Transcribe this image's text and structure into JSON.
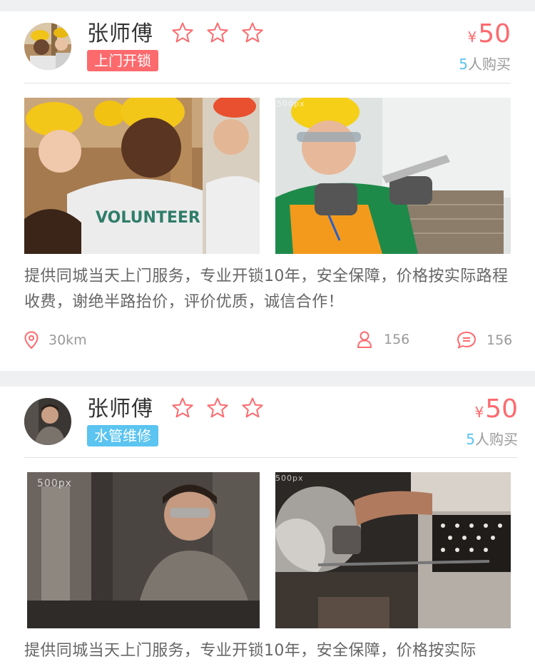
{
  "cards": [
    {
      "name": "张师傅",
      "rating_stars": 3,
      "tag": {
        "label": "上门开锁",
        "color": "#fc6a6e"
      },
      "price": {
        "currency": "¥",
        "amount": "50"
      },
      "buyers": {
        "count": "5",
        "suffix": "人购买"
      },
      "photos": [
        "volunteers-hardhats-photo",
        "worker-measuring-photo"
      ],
      "description": "提供同城当天上门服务，专业开锁10年，安全保障，价格按实际路程收费，谢绝半路抬价，评价优质，诚信合作！",
      "stats": {
        "distance": "30km",
        "users": "156",
        "comments": "156"
      }
    },
    {
      "name": "张师傅",
      "rating_stars": 3,
      "tag": {
        "label": "水管维修",
        "color": "#5bc4f0"
      },
      "price": {
        "currency": "¥",
        "amount": "50"
      },
      "buyers": {
        "count": "5",
        "suffix": "人购买"
      },
      "photos": [
        "metalworker-photo",
        "smoke-forge-photo"
      ],
      "description": "提供同城当天上门服务，专业开锁10年，安全保障，价格按实际"
    }
  ],
  "watermark": "500px",
  "icons": {
    "star": "star-outline-icon",
    "location": "location-pin-icon",
    "user": "user-icon",
    "comment": "comment-bubble-icon"
  },
  "colors": {
    "accent": "#fc6a6e",
    "blue": "#5bc4f0",
    "text": "#333333",
    "muted": "#999999"
  }
}
